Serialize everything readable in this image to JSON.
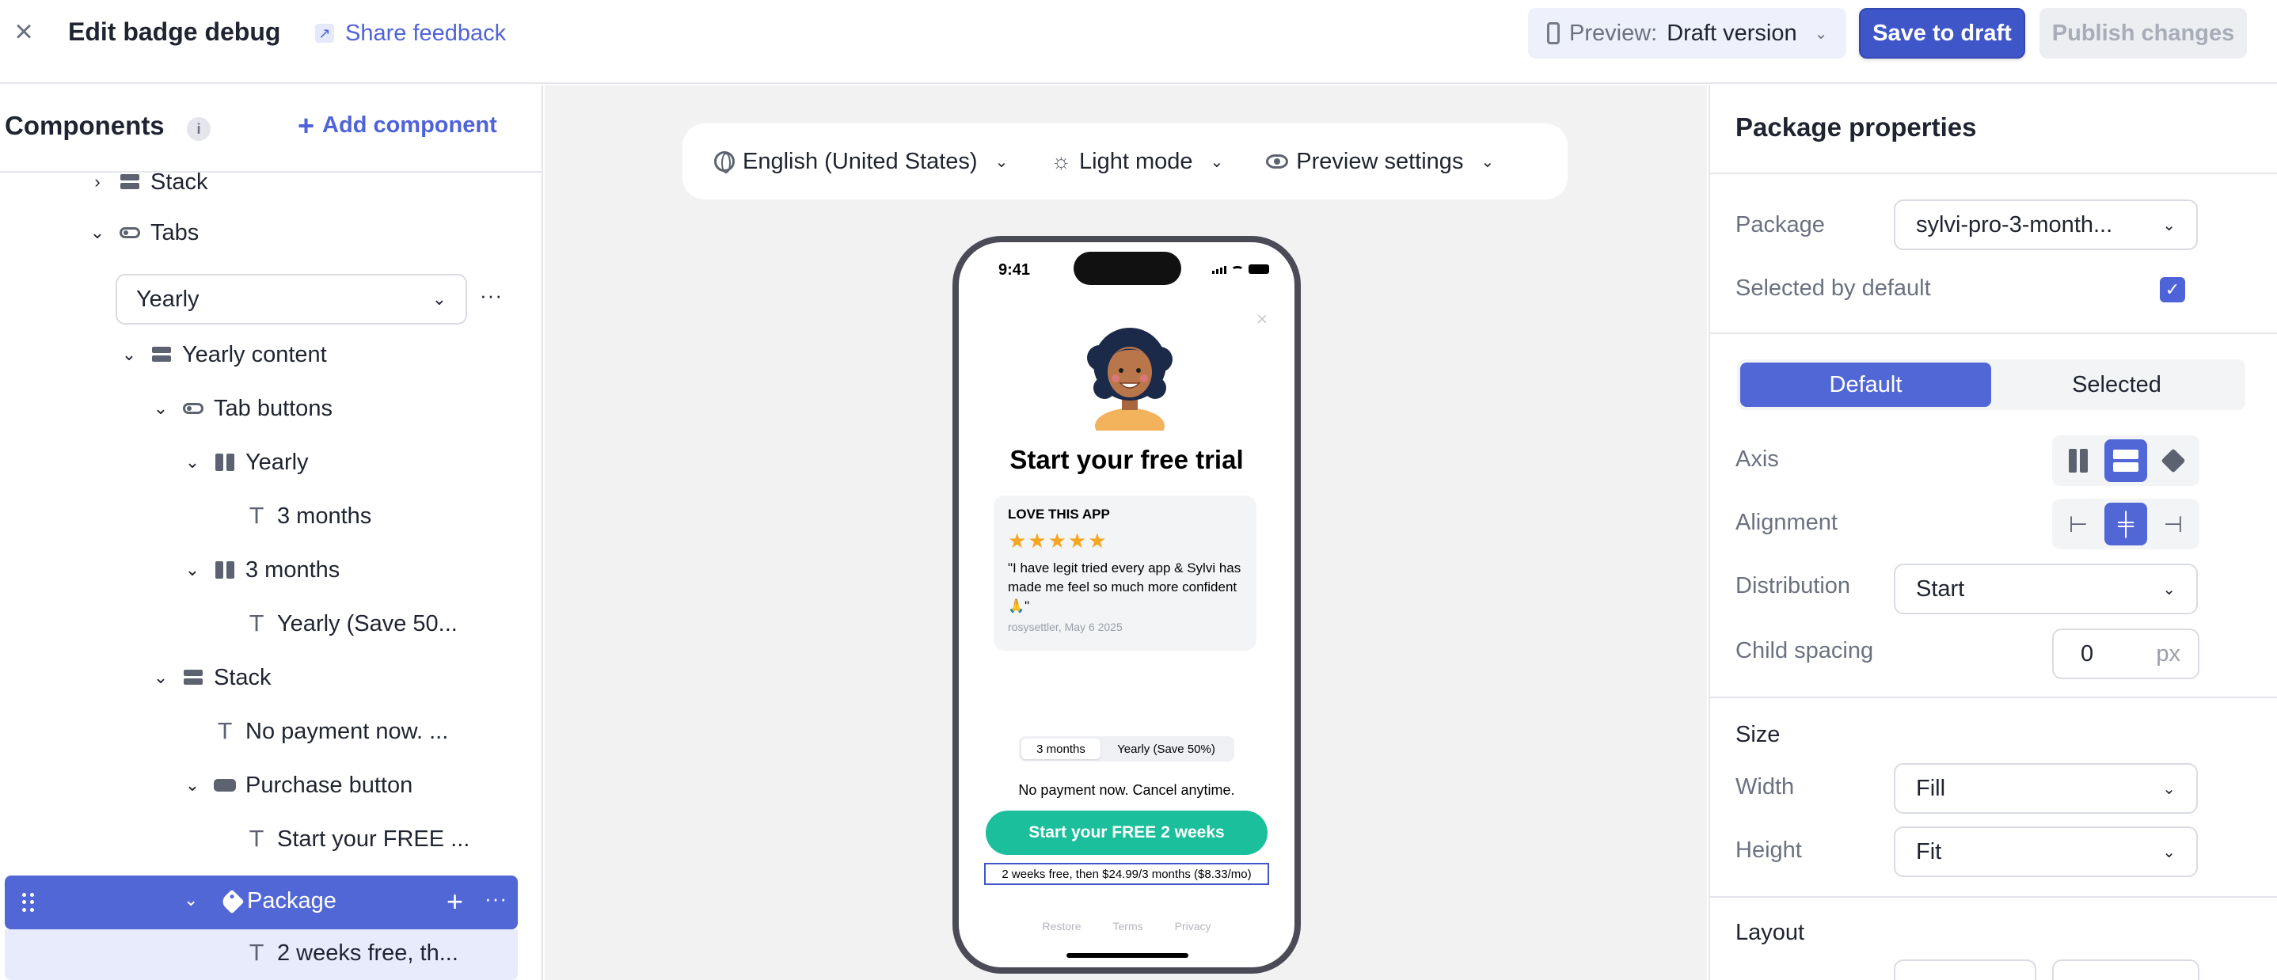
{
  "header": {
    "title": "Edit badge debug",
    "share_feedback": "Share feedback",
    "preview_prefix": "Preview:",
    "preview_value": "Draft version",
    "save_label": "Save to draft",
    "publish_label": "Publish changes"
  },
  "left_panel": {
    "title": "Components",
    "add_component": "Add component",
    "tab_select_value": "Yearly",
    "tree": [
      {
        "label": "Stack",
        "icon": "stack-icon",
        "expanded": false
      },
      {
        "label": "Tabs",
        "icon": "toggle-icon",
        "expanded": true
      },
      {
        "label": "Yearly content",
        "icon": "stack-icon",
        "expanded": true
      },
      {
        "label": "Tab buttons",
        "icon": "toggle-icon",
        "expanded": true
      },
      {
        "label": "Yearly",
        "icon": "columns-icon",
        "expanded": true
      },
      {
        "label": "3 months",
        "icon": "text-icon"
      },
      {
        "label": "3 months",
        "icon": "columns-icon",
        "expanded": true
      },
      {
        "label": "Yearly (Save 50...",
        "icon": "text-icon"
      },
      {
        "label": "Stack",
        "icon": "stack-icon",
        "expanded": true
      },
      {
        "label": "No payment now. ...",
        "icon": "text-icon"
      },
      {
        "label": "Purchase button",
        "icon": "button-icon",
        "expanded": true
      },
      {
        "label": "Start your FREE ...",
        "icon": "text-icon"
      },
      {
        "label": "Package",
        "icon": "tag-icon",
        "expanded": true,
        "selected": true
      },
      {
        "label": "2 weeks free, th...",
        "icon": "text-icon"
      }
    ]
  },
  "canvas": {
    "language": "English (United States)",
    "theme": "Light mode",
    "preview_settings": "Preview settings"
  },
  "phone": {
    "time": "9:41",
    "headline": "Start your free trial",
    "review_title": "LOVE THIS APP",
    "stars": "★★★★★",
    "review_text": "\"I have legit tried every app & Sylvi has made me feel so much more confident 🙏\"",
    "review_meta": "rosysettler, May 6 2025",
    "tab_1": "3 months",
    "tab_2": "Yearly (Save 50%)",
    "no_payment": "No payment now. Cancel anytime.",
    "cta": "Start your FREE 2 weeks",
    "subtext": "2 weeks free, then $24.99/3 months ($8.33/mo)",
    "footer": [
      "Restore",
      "Terms",
      "Privacy"
    ]
  },
  "right_panel": {
    "title": "Package properties",
    "package_label": "Package",
    "package_value": "sylvi-pro-3-month...",
    "selected_default_label": "Selected by default",
    "selected_default": true,
    "state_default": "Default",
    "state_selected": "Selected",
    "axis_label": "Axis",
    "alignment_label": "Alignment",
    "distribution_label": "Distribution",
    "distribution_value": "Start",
    "child_spacing_label": "Child spacing",
    "child_spacing_value": "0",
    "child_spacing_unit": "px",
    "size_title": "Size",
    "width_label": "Width",
    "width_value": "Fill",
    "height_label": "Height",
    "height_value": "Fit",
    "layout_title": "Layout"
  },
  "colors": {
    "accent": "#5267d6",
    "primary_button": "#3f56c9",
    "cta_green": "#1bbf9b",
    "star": "#f5a623"
  }
}
